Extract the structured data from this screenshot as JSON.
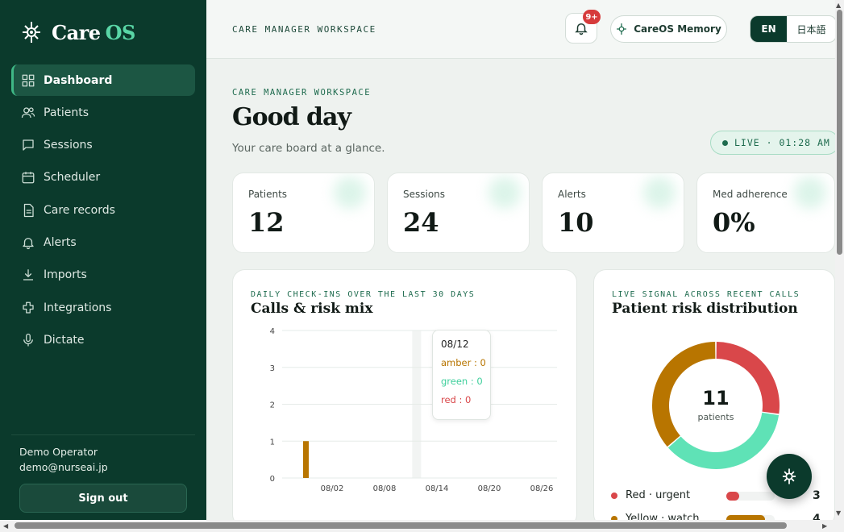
{
  "brand": {
    "name": "Care",
    "suffix": "OS"
  },
  "sidebar": {
    "items": [
      {
        "label": "Dashboard",
        "icon": "grid-icon",
        "active": true
      },
      {
        "label": "Patients",
        "icon": "users-icon"
      },
      {
        "label": "Sessions",
        "icon": "chat-icon"
      },
      {
        "label": "Scheduler",
        "icon": "calendar-icon"
      },
      {
        "label": "Care records",
        "icon": "document-icon"
      },
      {
        "label": "Alerts",
        "icon": "bell-icon"
      },
      {
        "label": "Imports",
        "icon": "download-icon"
      },
      {
        "label": "Integrations",
        "icon": "puzzle-icon"
      },
      {
        "label": "Dictate",
        "icon": "microphone-icon"
      }
    ],
    "operator": {
      "name": "Demo Operator",
      "email": "demo@nurseai.jp"
    },
    "signout_label": "Sign out"
  },
  "topbar": {
    "label": "CARE MANAGER WORKSPACE",
    "badge": "9+",
    "memory_label": "CareOS Memory",
    "lang_en": "EN",
    "lang_ja": "日本語"
  },
  "main": {
    "kicker": "CARE MANAGER WORKSPACE",
    "title": "Good day",
    "subtitle": "Your care board at a glance.",
    "live": "LIVE · 01:28 AM"
  },
  "stats": [
    {
      "label": "Patients",
      "value": "12"
    },
    {
      "label": "Sessions",
      "value": "24"
    },
    {
      "label": "Alerts",
      "value": "10"
    },
    {
      "label": "Med adherence",
      "value": "0%"
    }
  ],
  "calls_card": {
    "kicker": "DAILY CHECK-INS OVER THE LAST 30 DAYS",
    "title": "Calls & risk mix",
    "tooltip": {
      "date": "08/12",
      "amber": "amber : 0",
      "green": "green : 0",
      "red": "red : 0"
    }
  },
  "risk_card": {
    "kicker": "LIVE SIGNAL ACROSS RECENT CALLS",
    "title": "Patient risk distribution",
    "center_value": "11",
    "center_label": "patients",
    "legend": [
      {
        "label": "Red · urgent",
        "count": "3",
        "color": "#d9474a",
        "fill": 0.27
      },
      {
        "label": "Yellow · watch",
        "count": "4",
        "color": "#b87500",
        "fill": 0.8
      }
    ]
  },
  "colors": {
    "sidebar": "#0b3a2c",
    "accent": "#59d6a6",
    "red": "#d9474a",
    "amber": "#b87500",
    "green": "#5fe2b6"
  },
  "chart_data": [
    {
      "type": "bar",
      "title": "Calls & risk mix",
      "x_ticks": [
        "08/02",
        "08/08",
        "08/14",
        "08/20",
        "08/26"
      ],
      "ylim": [
        0,
        4
      ],
      "y_ticks": [
        0,
        1,
        2,
        3,
        4
      ],
      "grid": true,
      "series": [
        {
          "name": "amber",
          "color": "#b87500",
          "points": [
            {
              "x": "07/30",
              "y": 1
            }
          ]
        },
        {
          "name": "green",
          "color": "#5fe2b6",
          "points": []
        },
        {
          "name": "red",
          "color": "#d9474a",
          "points": []
        }
      ],
      "highlight": "08/12"
    },
    {
      "type": "pie",
      "title": "Patient risk distribution",
      "slices": [
        {
          "label": "Red · urgent",
          "value": 3,
          "color": "#d9474a"
        },
        {
          "label": "green",
          "value": 4,
          "color": "#5fe2b6"
        },
        {
          "label": "Yellow · watch",
          "value": 4,
          "color": "#b87500"
        }
      ]
    }
  ]
}
